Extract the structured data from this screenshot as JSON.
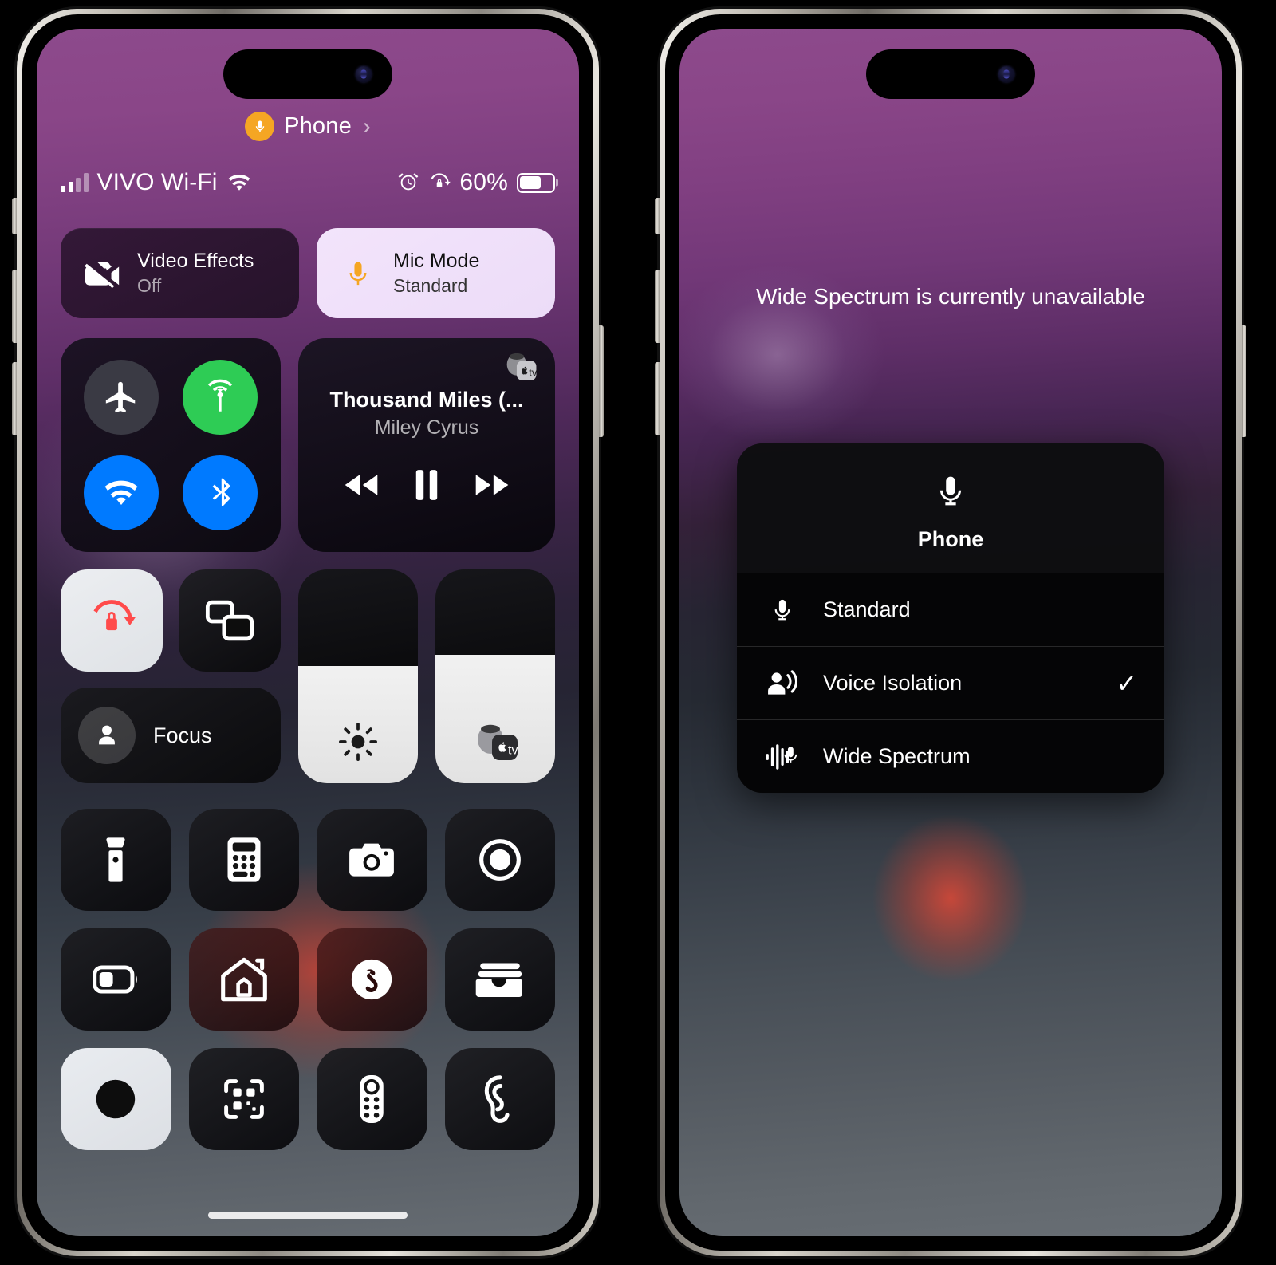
{
  "left_phone": {
    "mic_header": {
      "label": "Phone",
      "icon": "microphone-icon",
      "chevron": "›",
      "badge_color": "#F5A623"
    },
    "status_bar": {
      "carrier": "VIVO Wi-Fi",
      "signal_icon": "cellular-bars-icon",
      "wifi_icon": "wifi-icon",
      "alarm_icon": "alarm-clock-icon",
      "rotation_lock_icon": "rotation-lock-icon",
      "battery_percent": "60%",
      "battery_fill": 58
    },
    "effects": [
      {
        "title": "Video Effects",
        "subtitle": "Off",
        "icon": "video-off-icon",
        "style": "dark"
      },
      {
        "title": "Mic Mode",
        "subtitle": "Standard",
        "icon": "microphone-icon",
        "style": "light"
      }
    ],
    "connectivity": [
      {
        "name": "airplane-mode",
        "icon": "airplane-icon",
        "color": "#3a3a44",
        "active": false
      },
      {
        "name": "cellular-data",
        "icon": "cellular-antenna-icon",
        "color": "#2ECC55",
        "active": true
      },
      {
        "name": "wifi",
        "icon": "wifi-icon",
        "color": "#007AFF",
        "active": true
      },
      {
        "name": "bluetooth",
        "icon": "bluetooth-icon",
        "color": "#007AFF",
        "active": true
      }
    ],
    "media": {
      "title": "Thousand Miles (...",
      "artist": "Miley Cyrus",
      "airplay_icon": "apple-tv-airplay-icon",
      "prev_icon": "rewind-icon",
      "play_pause_icon": "pause-icon",
      "next_icon": "fast-forward-icon"
    },
    "controls": {
      "rotation_lock": {
        "icon": "rotation-lock-icon",
        "active": true,
        "accent": "#FF4B4B"
      },
      "screen_mirroring": {
        "icon": "screen-mirroring-icon",
        "active": false
      },
      "focus": {
        "label": "Focus",
        "icon": "person-icon"
      },
      "brightness": {
        "icon": "brightness-icon",
        "level": 55
      },
      "volume": {
        "icon": "apple-tv-volume-icon",
        "level": 60
      }
    },
    "grid": [
      {
        "name": "flashlight",
        "icon": "flashlight-icon",
        "style": "dark"
      },
      {
        "name": "calculator",
        "icon": "calculator-icon",
        "style": "dark"
      },
      {
        "name": "camera",
        "icon": "camera-icon",
        "style": "dark"
      },
      {
        "name": "screen-record",
        "icon": "screen-record-icon",
        "style": "dark"
      },
      {
        "name": "low-power-mode",
        "icon": "battery-low-icon",
        "style": "dark"
      },
      {
        "name": "home",
        "icon": "home-icon",
        "style": "warm"
      },
      {
        "name": "shazam",
        "icon": "shazam-icon",
        "style": "warm"
      },
      {
        "name": "wallet",
        "icon": "wallet-icon",
        "style": "dark"
      },
      {
        "name": "dark-mode",
        "icon": "dark-mode-icon",
        "style": "light"
      },
      {
        "name": "code-scanner",
        "icon": "qr-scanner-icon",
        "style": "dark"
      },
      {
        "name": "apple-tv-remote",
        "icon": "remote-icon",
        "style": "dark"
      },
      {
        "name": "hearing",
        "icon": "ear-icon",
        "style": "dark"
      }
    ]
  },
  "right_phone": {
    "toast": "Wide Spectrum is currently unavailable",
    "popup": {
      "header_label": "Phone",
      "header_icon": "microphone-icon",
      "items": [
        {
          "label": "Standard",
          "icon": "microphone-icon",
          "selected": false,
          "check": ""
        },
        {
          "label": "Voice Isolation",
          "icon": "voice-isolation-icon",
          "selected": true,
          "check": "✓"
        },
        {
          "label": "Wide Spectrum",
          "icon": "wide-spectrum-icon",
          "selected": false,
          "check": ""
        }
      ]
    }
  }
}
